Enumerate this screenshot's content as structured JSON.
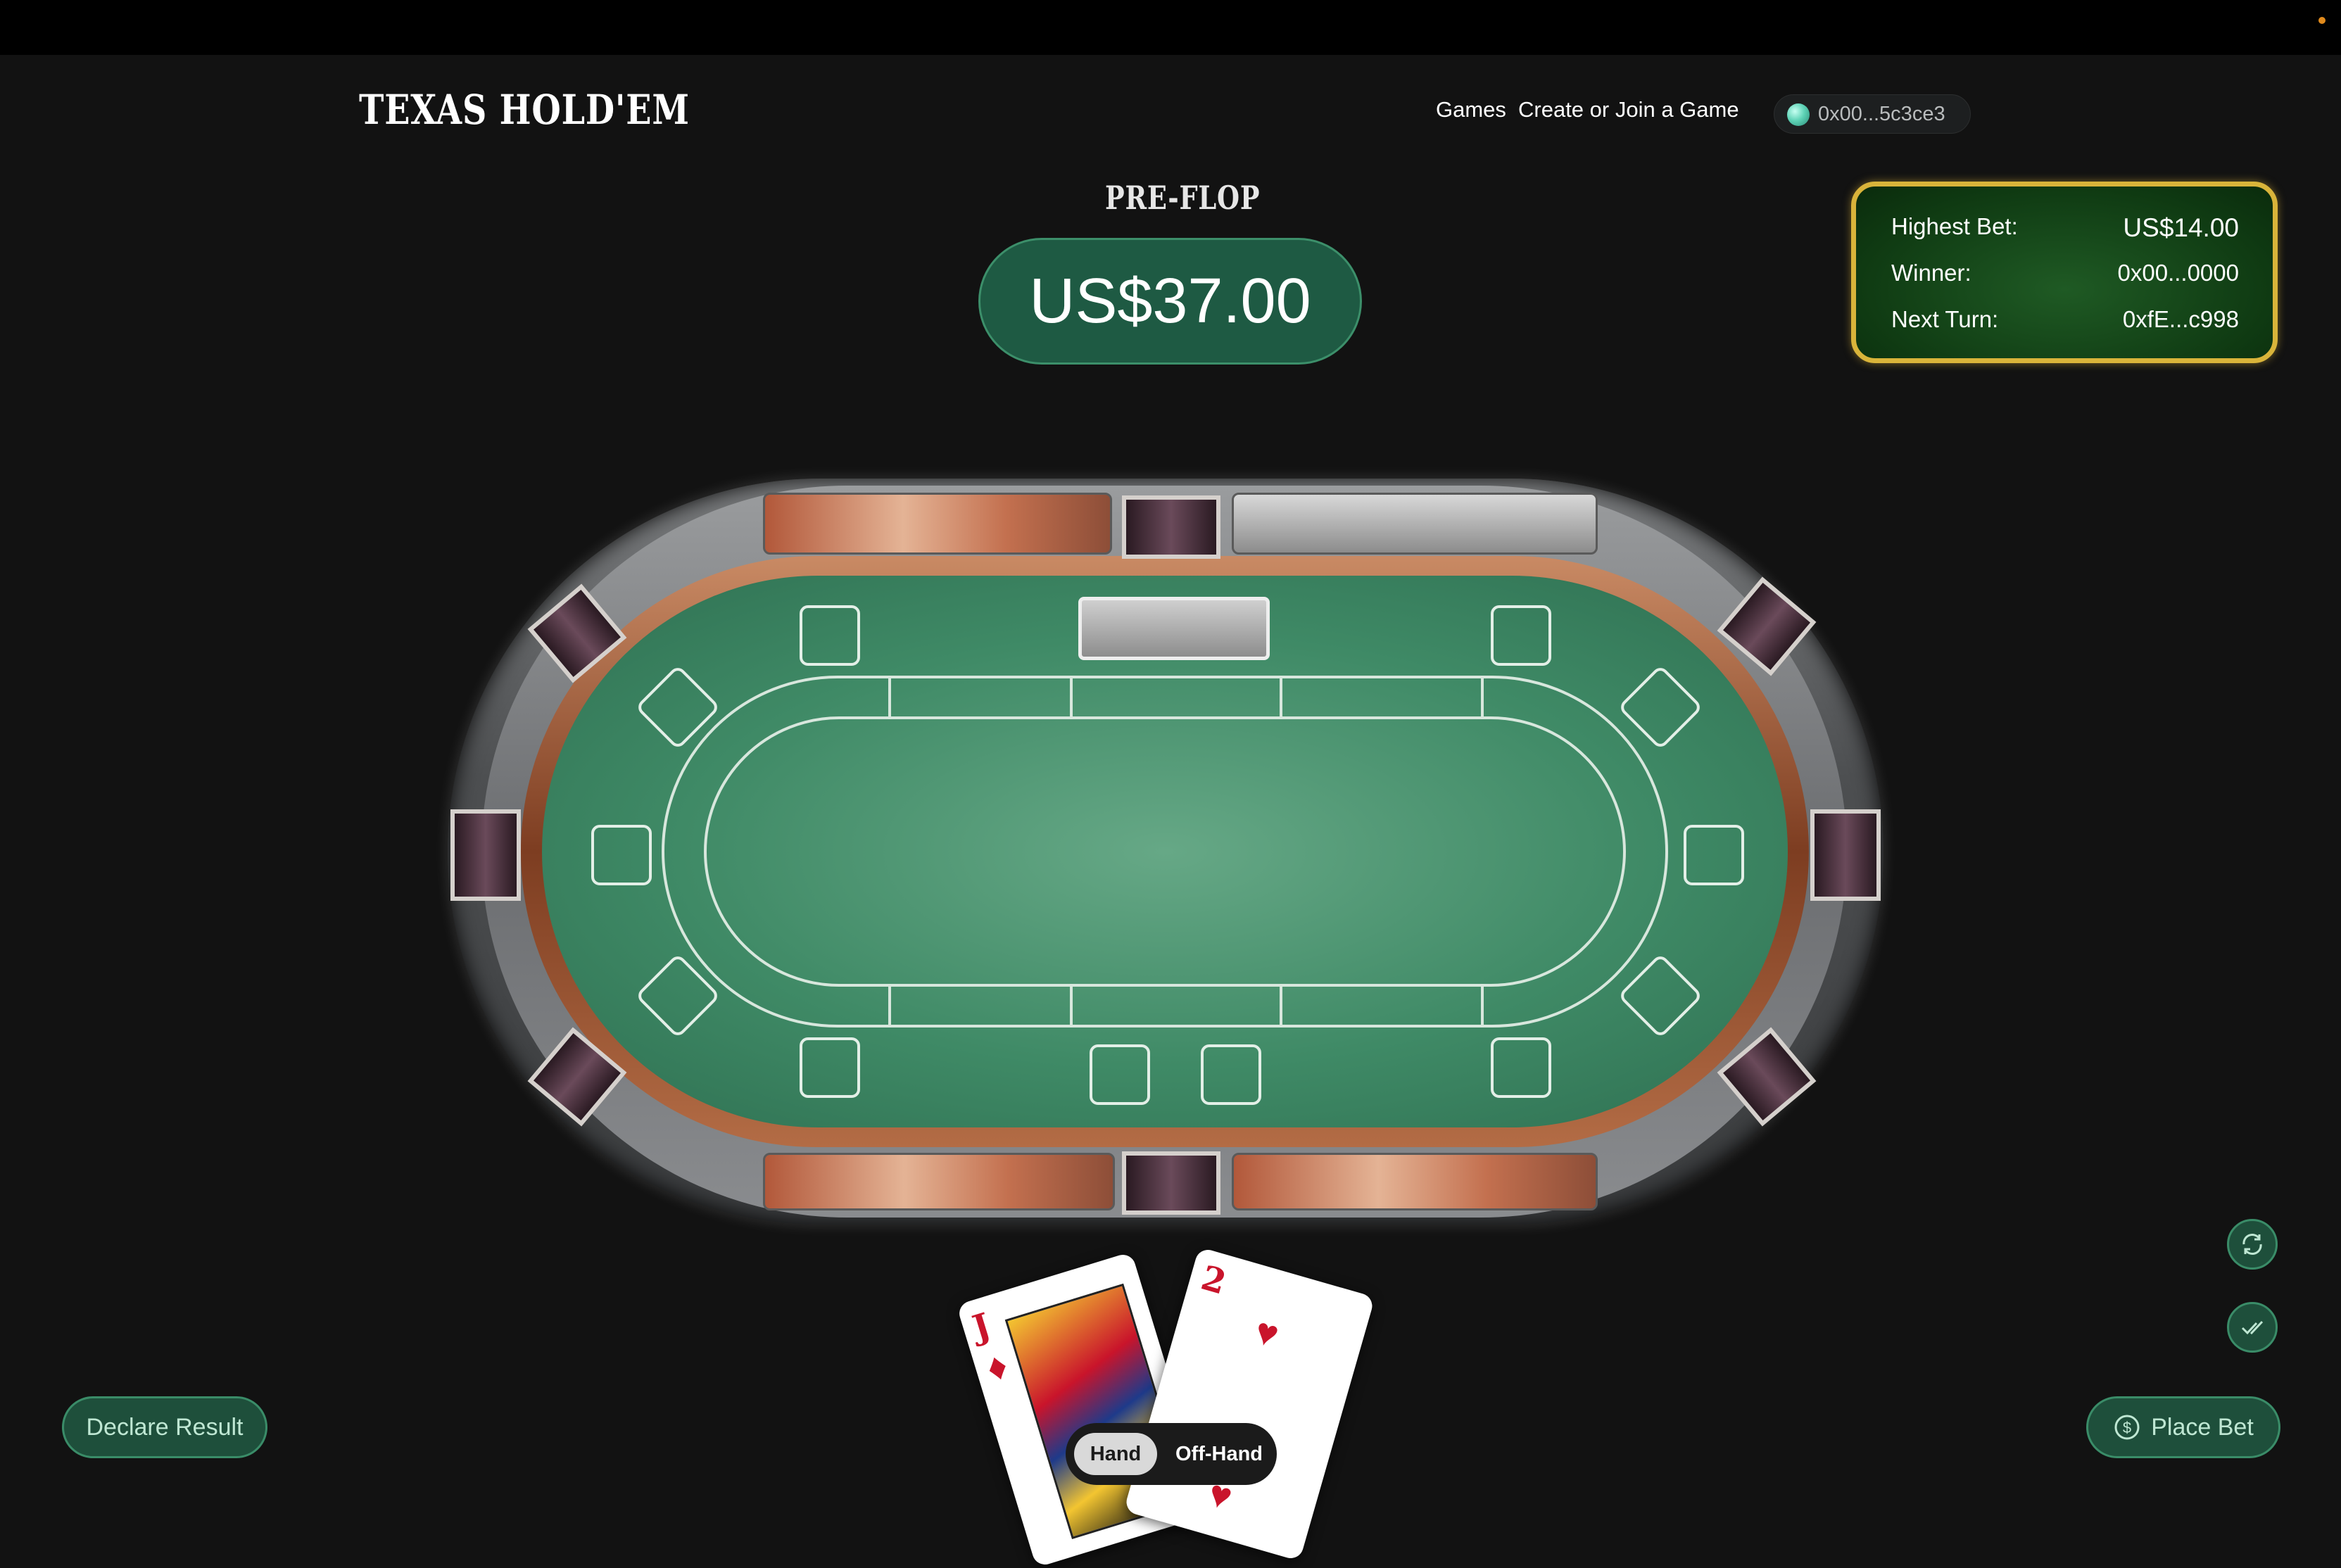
{
  "header": {
    "logo": "TEXAS HOLD'EM",
    "nav": {
      "games": "Games",
      "create_join": "Create or Join a Game"
    },
    "wallet": {
      "address": "0x00...5c3ce3",
      "icon": "wallet-gem-icon"
    }
  },
  "game": {
    "phase": "PRE-FLOP",
    "pot": "US$37.00"
  },
  "info_panel": {
    "highest_bet_label": "Highest Bet:",
    "highest_bet_value": "US$14.00",
    "winner_label": "Winner:",
    "winner_value": "0x00...0000",
    "next_turn_label": "Next Turn:",
    "next_turn_value": "0xfE...c998"
  },
  "player_hand": {
    "cards": [
      {
        "rank": "J",
        "suit": "♦"
      },
      {
        "rank": "2",
        "suit": "♥"
      }
    ],
    "toggle": {
      "hand": "Hand",
      "off_hand": "Off-Hand",
      "selected": "Hand"
    }
  },
  "actions": {
    "declare_result": "Declare Result",
    "place_bet": "Place Bet",
    "refresh_icon": "refresh-icon",
    "check_icon": "double-check-icon"
  },
  "colors": {
    "accent_green": "#1e4f3b",
    "felt_green": "#3f8a66",
    "gold_border": "#d9b43a"
  }
}
